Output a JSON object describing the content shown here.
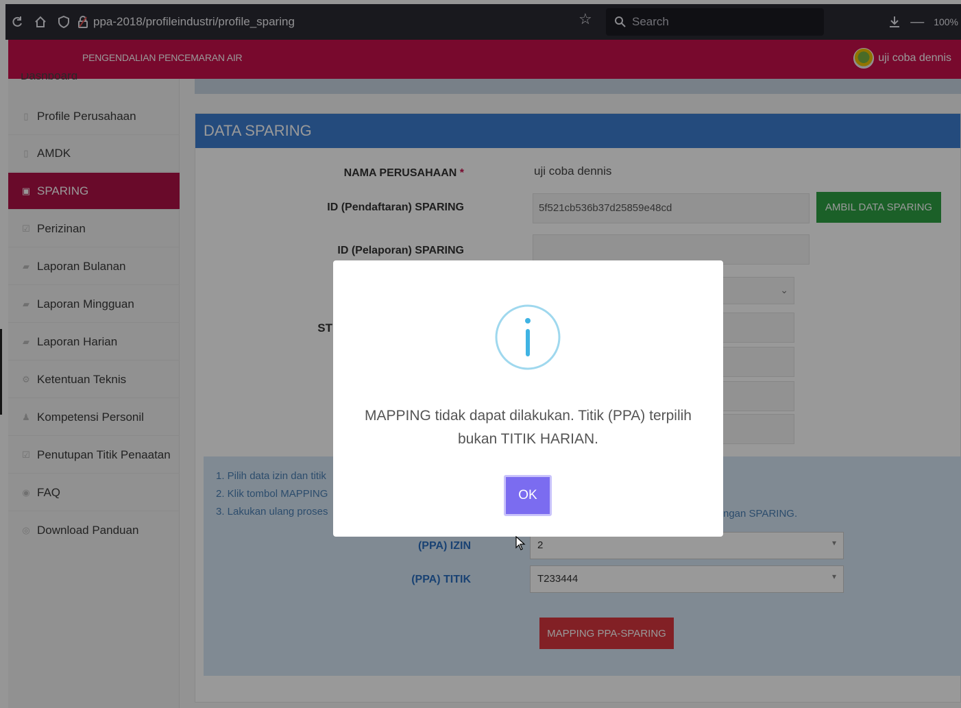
{
  "browser": {
    "url": "ppa-2018/profileindustri/profile_sparing",
    "search_placeholder": "Search",
    "zoom": "100%"
  },
  "header": {
    "app_title": "PENGENDALIAN PENCEMARAN AIR",
    "user_name": "uji coba dennis"
  },
  "sidebar": {
    "partial_item": "Dashboard",
    "items": [
      {
        "label": "Profile Perusahaan",
        "icon": "building-icon"
      },
      {
        "label": "AMDK",
        "icon": "building-icon"
      },
      {
        "label": "SPARING",
        "icon": "building-icon",
        "active": true
      },
      {
        "label": "Perizinan",
        "icon": "checkbox-icon"
      },
      {
        "label": "Laporan Bulanan",
        "icon": "book-icon"
      },
      {
        "label": "Laporan Mingguan",
        "icon": "book-icon"
      },
      {
        "label": "Laporan Harian",
        "icon": "book-icon"
      },
      {
        "label": "Ketentuan Teknis",
        "icon": "gears-icon"
      },
      {
        "label": "Kompetensi Personil",
        "icon": "person-icon"
      },
      {
        "label": "Penutupan Titik Penaatan",
        "icon": "checkbox-icon"
      },
      {
        "label": "FAQ",
        "icon": "question-icon"
      },
      {
        "label": "Download Panduan",
        "icon": "download-icon"
      }
    ]
  },
  "panel": {
    "title": "DATA SPARING",
    "nama_label": "NAMA PERUSAHAAN",
    "nama_required": "*",
    "nama_value": "uji coba dennis",
    "id_daftar_label": "ID (Pendaftaran) SPARING",
    "id_daftar_value": "5f521cb536b37d25859e48cd",
    "ambil_button": "AMBIL DATA SPARING",
    "id_lapor_label": "ID (Pelaporan) SPARING",
    "partial_label": "ST"
  },
  "info": {
    "step1": "1. Pilih data izin dan titik",
    "step2": "2. Klik tombol MAPPING",
    "step3": "3. Lakukan ulang proses",
    "step3_trailing": "ngan SPARING.",
    "izin_label": "(PPA) IZIN",
    "izin_value": "2",
    "titik_label": "(PPA) TITIK",
    "titik_value": "T233444",
    "mapping_button": "MAPPING PPA-SPARING"
  },
  "modal": {
    "icon": "info-icon",
    "message": "MAPPING tidak dapat dilakukan. Titik (PPA) terpilih bukan TITIK HARIAN.",
    "ok_label": "OK"
  },
  "colors": {
    "header": "#c8104c",
    "sidebar_active": "#b01247",
    "panel_head": "#3d7dd1",
    "ok_button": "#7b6cf0",
    "green_button": "#2ea043",
    "red_button": "#d9363e"
  }
}
